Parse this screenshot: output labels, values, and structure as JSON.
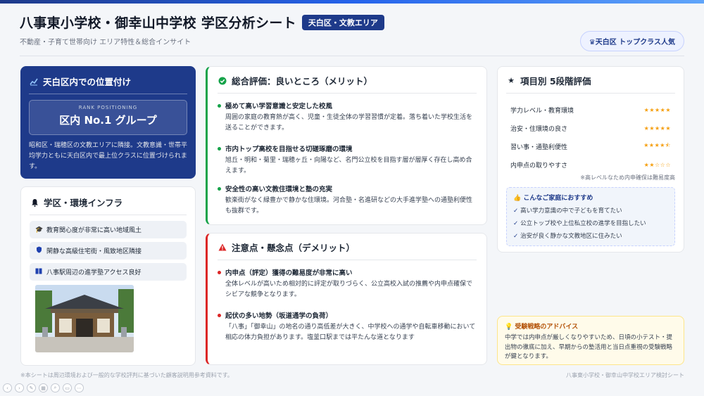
{
  "header": {
    "title": "八事東小学校・御幸山中学校 学区分析シート",
    "badge": "天白区・文教エリア",
    "subtitle": "不動産・子育て世帯向け エリア特性＆総合インサイト",
    "top_pill": "天白区 トップクラス人気"
  },
  "position": {
    "title": "天白区内での位置付け",
    "rank_label": "RANK POSITIONING",
    "rank_value": "区内 No.1 グループ",
    "text": "昭和区・瑞穂区の文教エリアに隣接。文教意識・世帯平均学力ともに天白区内で最上位クラスに位置づけられます。"
  },
  "infra": {
    "title": "学区・環境インフラ",
    "items": [
      {
        "label": "教育関心度が非常に高い地域風土",
        "icon": "graduation-cap-icon"
      },
      {
        "label": "閑静な高級住宅街・風致地区隣接",
        "icon": "shield-icon"
      },
      {
        "label": "八事駅周辺の進学塾アクセス良好",
        "icon": "book-icon"
      }
    ]
  },
  "merit": {
    "title": "総合評価：良いところ（メリット）",
    "color": "#16a34a",
    "points": [
      {
        "head": "極めて高い学習意識と安定した校風",
        "body": "周囲の家庭の教育熱が高く、児童・生徒全体の学習習慣が定着。落ち着いた学校生活を送ることができます。"
      },
      {
        "head": "市内トップ高校を目指せる切磋琢磨の環境",
        "body": "旭丘・明和・菊里・瑞穂ヶ丘・向陽など、名門公立校を目指す層が層厚く存在し高め合えます。"
      },
      {
        "head": "安全性の高い文教住環境と塾の充実",
        "body": "歓楽街がなく緑豊かで静かな住環境。河合塾・名進研などの大手進学塾への通塾利便性も抜群です。"
      }
    ]
  },
  "demerit": {
    "title": "注意点・懸念点（デメリット）",
    "color": "#dc2626",
    "points": [
      {
        "head": "内申点（評定）獲得の難易度が非常に高い",
        "body": "全体レベルが高いため相対的に評定が取りづらく、公立高校入試の推薦や内申点確保でシビアな競争となります。"
      },
      {
        "head": "起伏の多い地勢（坂道通学の負荷）",
        "body": "「八事」「御幸山」の地名の通り高低差が大きく、中学校への通学や自転車移動において相応の体力負担があります。塩釜口駅までは平たんな道となります"
      }
    ]
  },
  "rating": {
    "title": "項目別 5段階評価",
    "star_color": "#f59e0b",
    "items": [
      {
        "label": "学力レベル・教育環境",
        "stars": "★★★★★",
        "value": 5
      },
      {
        "label": "治安・住環境の良さ",
        "stars": "★★★★★",
        "value": 5
      },
      {
        "label": "習い事・通塾利便性",
        "stars": "★★★★⯪",
        "value": 4.5
      },
      {
        "label": "内申点の取りやすさ",
        "stars": "★★☆☆☆",
        "value": 2
      }
    ],
    "note": "※高レベルなため内申確保は難易度高"
  },
  "family": {
    "title": "こんなご家庭におすすめ",
    "items": [
      "高い学力意識の中で子どもを育てたい",
      "公立トップ校や上位私立校の進学を目指したい",
      "治安が良く静かな文教地区に住みたい"
    ]
  },
  "advice": {
    "title": "受験戦略のアドバイス",
    "body": "中学では内申点が厳しくなりやすいため、日頃の小テスト・提出物の徹底に加え、早期からの塾活用と当日点重視の受験戦略が鍵となります。"
  },
  "footer": {
    "left": "※本シートは周辺環境および一般的な学校評判に基づいた顧客説明用参考資料です。",
    "right": "八事東小学校・御幸山中学校エリア検討シート"
  }
}
